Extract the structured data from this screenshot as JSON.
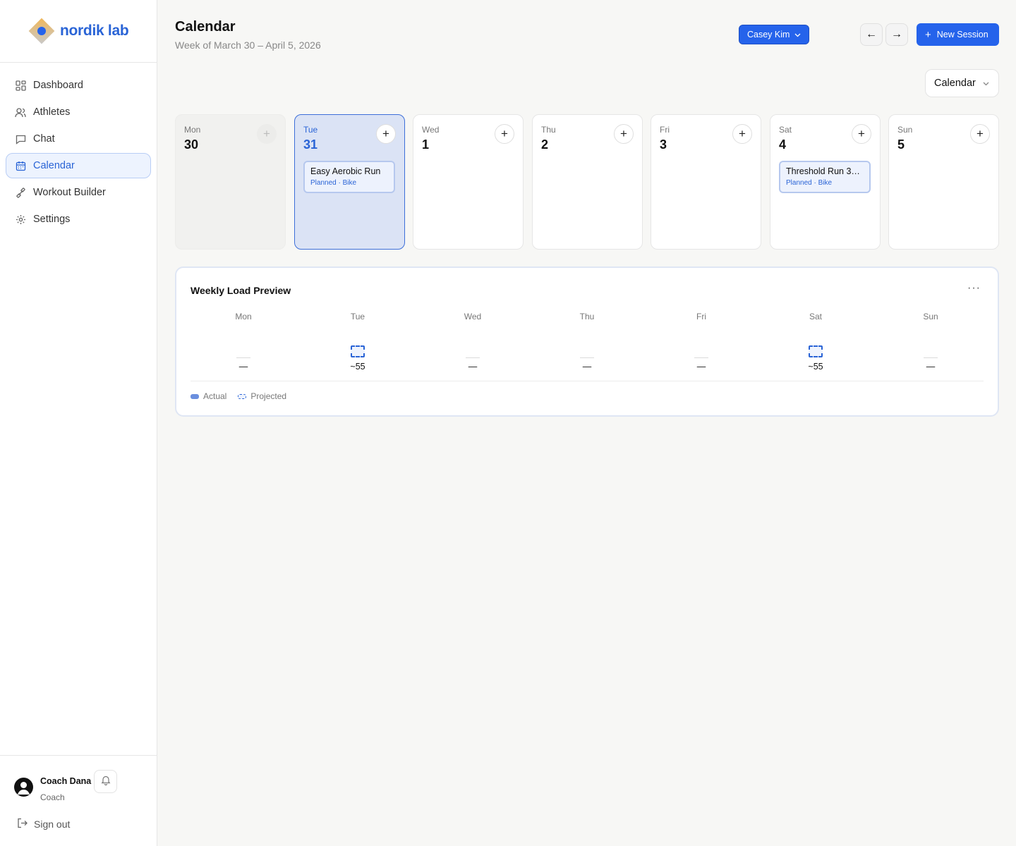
{
  "app": {
    "logo_text": "nordik lab"
  },
  "sidebar": {
    "items": [
      {
        "label": "Dashboard",
        "icon": "dashboard-icon"
      },
      {
        "label": "Athletes",
        "icon": "users-icon"
      },
      {
        "label": "Chat",
        "icon": "chat-icon"
      },
      {
        "label": "Calendar",
        "icon": "calendar-icon",
        "active": true
      },
      {
        "label": "Workout Builder",
        "icon": "dumbbell-icon"
      },
      {
        "label": "Settings",
        "icon": "gear-icon"
      }
    ],
    "user": {
      "name": "Coach Dana",
      "role": "Coach"
    },
    "signout_label": "Sign out"
  },
  "header": {
    "title": "Calendar",
    "subtitle": "Week of March 30 – April 5, 2026",
    "athlete": "Casey Kim",
    "prev_label": "←",
    "next_label": "→",
    "new_session_label": "New Session",
    "view": "Calendar"
  },
  "days": [
    {
      "name": "Mon",
      "num": "30",
      "state": "past"
    },
    {
      "name": "Tue",
      "num": "31",
      "state": "today",
      "session": {
        "title": "Easy Aerobic Run",
        "meta": "Planned · Bike"
      }
    },
    {
      "name": "Wed",
      "num": "1"
    },
    {
      "name": "Thu",
      "num": "2"
    },
    {
      "name": "Fri",
      "num": "3"
    },
    {
      "name": "Sat",
      "num": "4",
      "session": {
        "title": "Threshold Run 3×1…",
        "meta": "Planned · Bike"
      }
    },
    {
      "name": "Sun",
      "num": "5"
    }
  ],
  "weekly_load": {
    "title": "Weekly Load Preview",
    "more_label": "···",
    "columns": [
      {
        "day": "Mon",
        "value": "—"
      },
      {
        "day": "Tue",
        "value": "~55",
        "projected": true
      },
      {
        "day": "Wed",
        "value": "—"
      },
      {
        "day": "Thu",
        "value": "—"
      },
      {
        "day": "Fri",
        "value": "—"
      },
      {
        "day": "Sat",
        "value": "~55",
        "projected": true
      },
      {
        "day": "Sun",
        "value": "—"
      }
    ],
    "legend": {
      "actual": "Actual",
      "projected": "Projected"
    }
  },
  "colors": {
    "accent": "#2563eb",
    "today_bg": "#dbe3f5"
  }
}
